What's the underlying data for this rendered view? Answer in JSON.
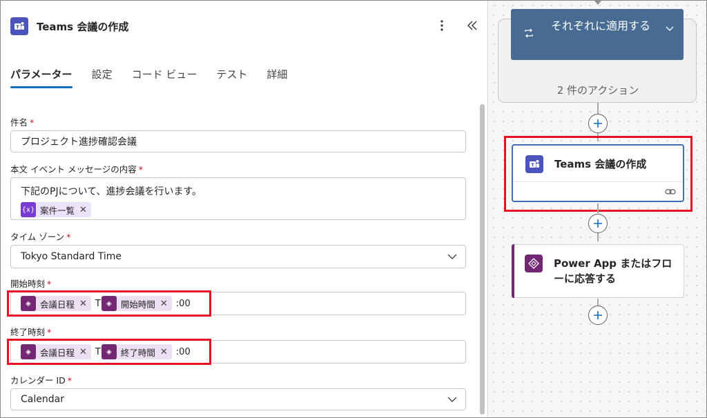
{
  "panel": {
    "title": "Teams 会議の作成",
    "tabs": [
      "パラメーター",
      "設定",
      "コード ビュー",
      "テスト",
      "詳細"
    ]
  },
  "fields": {
    "subject": {
      "label": "件名",
      "value": "プロジェクト進捗確認会議"
    },
    "body": {
      "label": "本文 イベント メッセージの内容",
      "text": "下記のPJについて、進捗会議を行います。",
      "token": "案件一覧"
    },
    "timezone": {
      "label": "タイム ゾーン",
      "value": "Tokyo Standard Time"
    },
    "start": {
      "label": "開始時刻",
      "token1": "会議日程",
      "separator": "T",
      "token2": "開始時間",
      "suffix": ":00"
    },
    "end": {
      "label": "終了時刻",
      "token1": "会議日程",
      "separator": "T",
      "token2": "終了時間",
      "suffix": ":00"
    },
    "calendar": {
      "label": "カレンダー ID",
      "value": "Calendar"
    }
  },
  "canvas": {
    "group": {
      "title": "それぞれに適用する",
      "subtitle": "2 件のアクション"
    },
    "teams_action": {
      "title": "Teams 会議の作成"
    },
    "power_app_action": {
      "title_line1": "Power App またはフロ",
      "title_line2": "ーに応答する"
    }
  },
  "colors": {
    "teams": "#4b53bc",
    "power_apps": "#742774",
    "accent": "#0f6cbd",
    "highlight": "#e81123",
    "group_header": "#476b93"
  }
}
